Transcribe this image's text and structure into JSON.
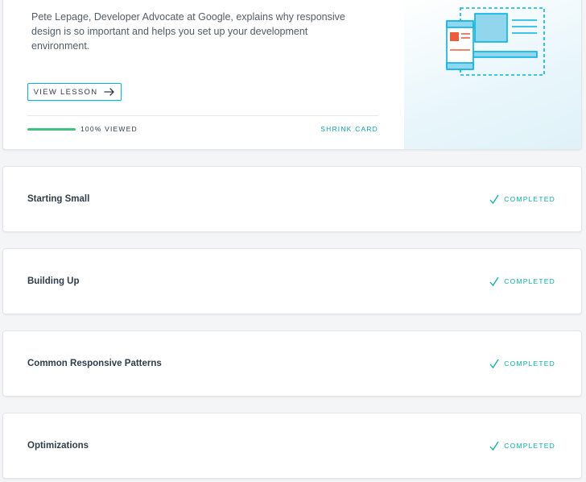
{
  "hero": {
    "description": "Pete Lepage, Developer Advocate at Google, explains why responsive design is so important and helps you set up your development environment.",
    "view_lesson_label": "VIEW LESSON",
    "progress_label": "100% VIEWED",
    "progress": 1.0,
    "shrink_label": "SHRINK CARD"
  },
  "lessons": [
    {
      "title": "Starting Small",
      "status": "COMPLETED"
    },
    {
      "title": "Building Up",
      "status": "COMPLETED"
    },
    {
      "title": "Common Responsive Patterns",
      "status": "COMPLETED"
    },
    {
      "title": "Optimizations",
      "status": "COMPLETED"
    }
  ],
  "colors": {
    "accent": "#02b3e4",
    "progress": "#3fc380",
    "completed": "#02b3a4",
    "illus_orange": "#f15b3b"
  },
  "icons": [
    "arrow-right-icon",
    "check-icon",
    "responsive-devices-illustration"
  ]
}
